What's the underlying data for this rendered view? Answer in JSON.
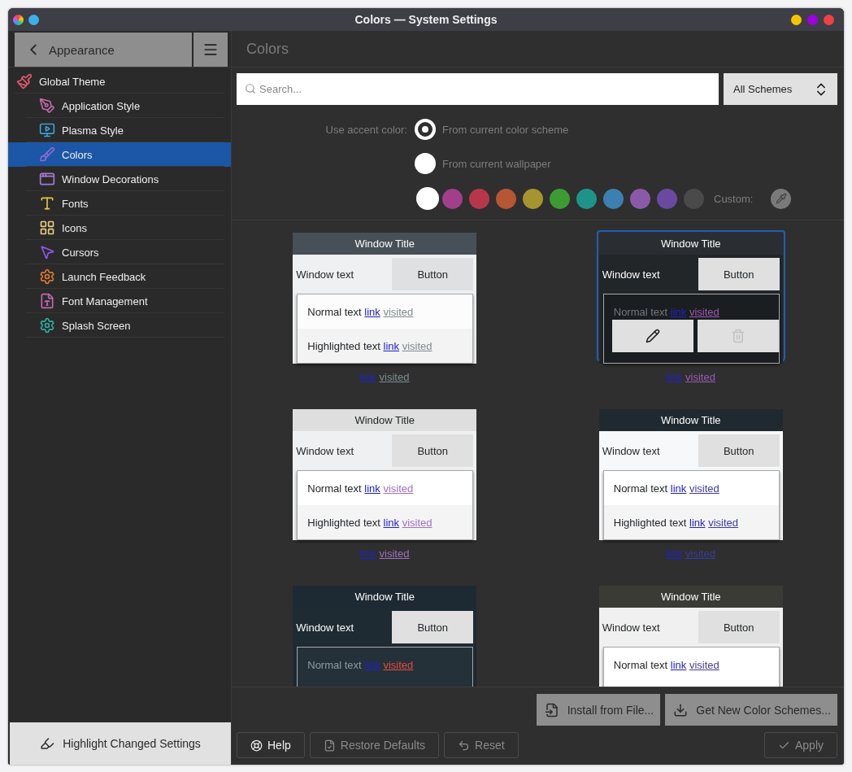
{
  "window": {
    "title": "Colors — System Settings"
  },
  "sidebar": {
    "back_button": "Appearance",
    "items": [
      {
        "label": "Global Theme",
        "selected": false,
        "children": [
          {
            "label": "Application Style",
            "selected": false
          },
          {
            "label": "Plasma Style",
            "selected": false
          },
          {
            "label": "Colors",
            "selected": true
          },
          {
            "label": "Window Decorations",
            "selected": false
          },
          {
            "label": "Fonts",
            "selected": false
          },
          {
            "label": "Icons",
            "selected": false
          },
          {
            "label": "Cursors",
            "selected": false
          },
          {
            "label": "Launch Feedback",
            "selected": false
          },
          {
            "label": "Font Management",
            "selected": false
          },
          {
            "label": "Splash Screen",
            "selected": false
          }
        ]
      }
    ],
    "highlight_button": "Highlight Changed Settings"
  },
  "page": {
    "title": "Colors",
    "search": {
      "placeholder": "Search..."
    },
    "filter": {
      "value": "All Schemes"
    },
    "accent": {
      "label": "Use accent color:",
      "options": [
        {
          "label": "From current color scheme",
          "selected": true
        },
        {
          "label": "From current wallpaper",
          "selected": false
        }
      ],
      "custom": {
        "selected": false,
        "label": "Custom:",
        "swatches": [
          {
            "color": "#a33e8a"
          },
          {
            "color": "#b8364a"
          },
          {
            "color": "#b65632"
          },
          {
            "color": "#a5942f"
          },
          {
            "color": "#3c9b33"
          },
          {
            "color": "#1e9488"
          },
          {
            "color": "#3b80b0"
          },
          {
            "color": "#8a5aa8"
          },
          {
            "color": "#6a4aa0"
          },
          {
            "color": "#4a4a4a"
          }
        ]
      }
    },
    "schemes": [
      {
        "selected": false,
        "color": "#475057",
        "title": "Window Title",
        "window_text": "Window text",
        "button": "Button",
        "lines": [
          {
            "kind": "normal",
            "text": "Normal text",
            "link": "link",
            "visited": "visited"
          },
          {
            "kind": "highlighted",
            "text": "Highlighted text",
            "link": "link",
            "visited": "visited"
          }
        ],
        "footer": {
          "link": "link",
          "visited": "visited"
        }
      },
      {
        "selected": true,
        "color": "#2a2e32",
        "title": "Window Title",
        "window_text": "Window text",
        "button": "Button",
        "lines": [
          {
            "kind": "normal",
            "text": "Normal text",
            "link": "link",
            "visited": "visited"
          }
        ],
        "footer": {
          "link": "link",
          "visited": "visited"
        },
        "actions": [
          {
            "kind": "edit",
            "disabled": false
          },
          {
            "kind": "delete",
            "disabled": true
          }
        ]
      },
      {
        "selected": false,
        "color": "#dedede",
        "title": "Window Title",
        "window_text": "Window text",
        "button": "Button",
        "lines": [
          {
            "kind": "normal",
            "text": "Normal text",
            "link": "link",
            "visited": "visited"
          },
          {
            "kind": "highlighted",
            "text": "Highlighted text",
            "link": "link",
            "visited": "visited"
          }
        ],
        "footer": {
          "link": "link",
          "visited": "visited"
        }
      },
      {
        "selected": false,
        "color": "#1f2a30",
        "title": "Window Title",
        "window_text": "Window text",
        "button": "Button",
        "lines": [
          {
            "kind": "normal",
            "text": "Normal text",
            "link": "link",
            "visited": "visited"
          },
          {
            "kind": "highlighted",
            "text": "Highlighted text",
            "link": "link",
            "visited": "visited"
          }
        ],
        "footer": {
          "link": "link",
          "visited": "visited"
        }
      },
      {
        "selected": false,
        "color": "#1e2a33",
        "title": "Window Title",
        "window_text": "Window text",
        "button": "Button",
        "lines": [
          {
            "kind": "normal",
            "text": "Normal text",
            "link": "link",
            "visited": "visited"
          }
        ]
      },
      {
        "selected": false,
        "color": "#3b3b36",
        "title": "Window Title",
        "window_text": "Window text",
        "button": "Button",
        "lines": [
          {
            "kind": "normal",
            "text": "Normal text",
            "link": "link",
            "visited": "visited"
          }
        ]
      }
    ],
    "install_buttons": [
      "Install from File...",
      "Get New Color Schemes..."
    ]
  },
  "footer": {
    "buttons": [
      {
        "kind": "help",
        "label": "Help",
        "disabled": false
      },
      {
        "kind": "restore",
        "label": "Restore Defaults",
        "disabled": true
      },
      {
        "kind": "reset",
        "label": "Reset",
        "disabled": true
      },
      {
        "kind": "apply",
        "label": "Apply",
        "disabled": true
      }
    ]
  }
}
